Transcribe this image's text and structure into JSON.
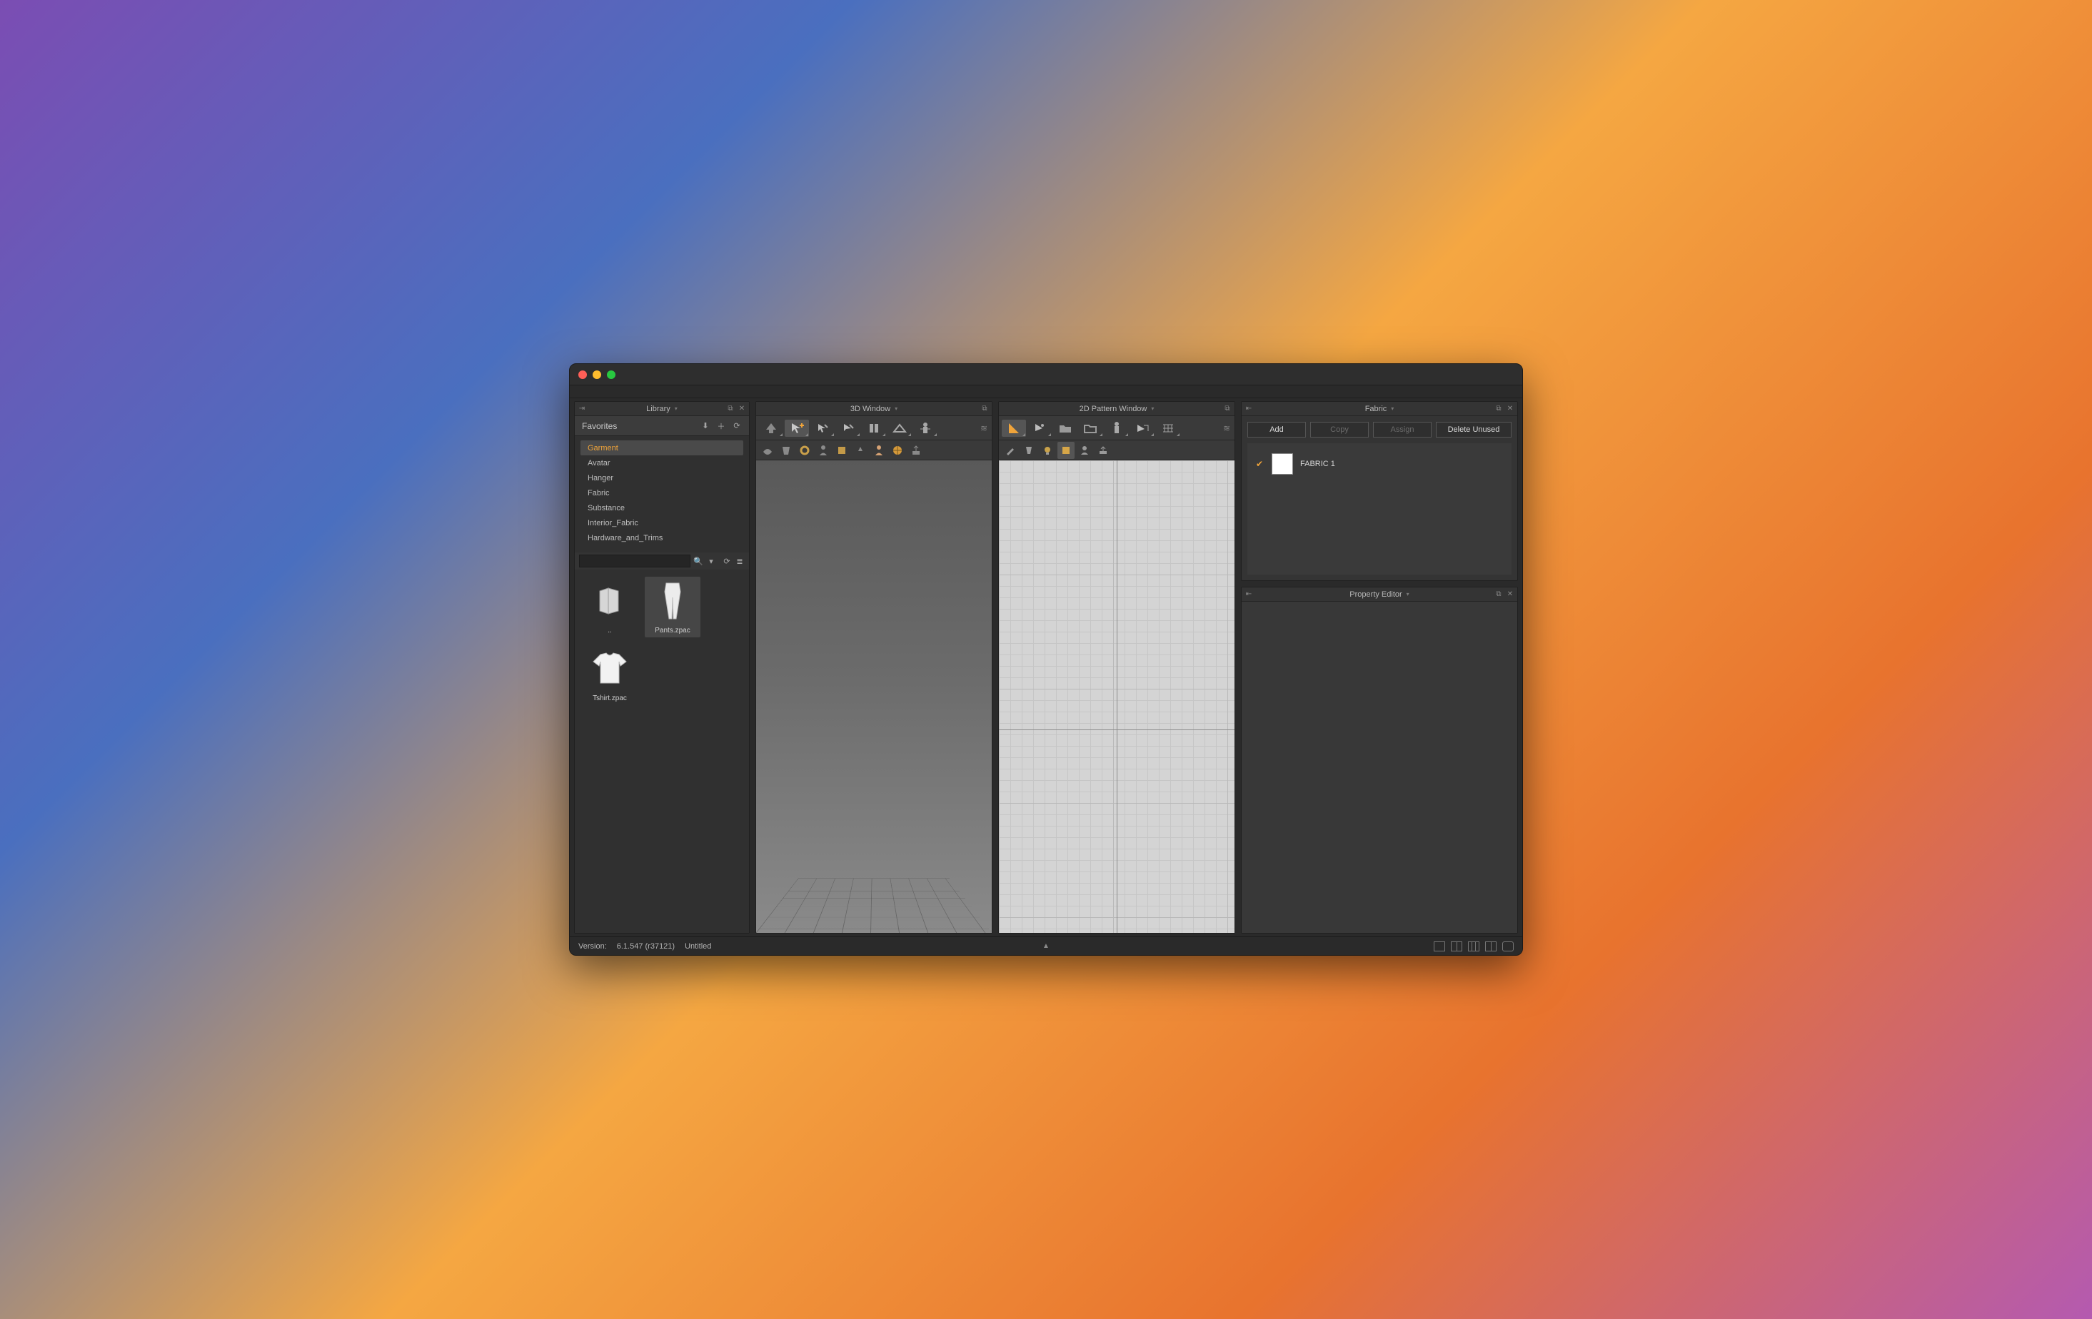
{
  "panels": {
    "library": {
      "title": "Library"
    },
    "window3d": {
      "title": "3D Window"
    },
    "window2d": {
      "title": "2D Pattern Window"
    },
    "fabric": {
      "title": "Fabric"
    },
    "propedit": {
      "title": "Property Editor"
    }
  },
  "library": {
    "favorites_label": "Favorites",
    "categories": [
      {
        "label": "Garment",
        "active": true
      },
      {
        "label": "Avatar"
      },
      {
        "label": "Hanger"
      },
      {
        "label": "Fabric"
      },
      {
        "label": "Substance"
      },
      {
        "label": "Interior_Fabric"
      },
      {
        "label": "Hardware_and_Trims"
      }
    ],
    "search_placeholder": "",
    "items": {
      "up": {
        "label": ".."
      },
      "pants": {
        "label": "Pants.zpac"
      },
      "tshirt": {
        "label": "Tshirt.zpac"
      }
    }
  },
  "fabric": {
    "buttons": {
      "add": "Add",
      "copy": "Copy",
      "assign": "Assign",
      "delete_unused": "Delete Unused"
    },
    "rows": [
      {
        "name": "FABRIC 1",
        "swatch": "#ffffff"
      }
    ]
  },
  "status": {
    "version_label": "Version:",
    "version_value": "6.1.547 (r37121)",
    "filename": "Untitled"
  }
}
